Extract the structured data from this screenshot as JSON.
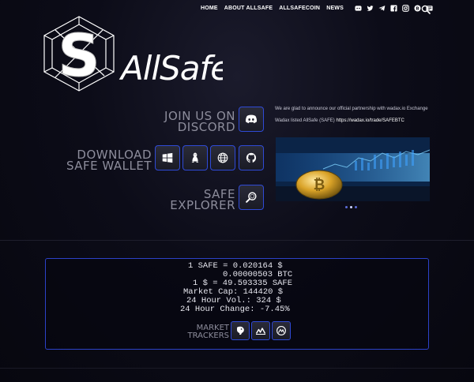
{
  "nav": {
    "links": [
      "HOME",
      "ABOUT ALLSAFE",
      "ALLSAFECOIN",
      "NEWS"
    ],
    "icons": [
      "discord-icon",
      "twitter-icon",
      "telegram-icon",
      "facebook-icon",
      "instagram-icon",
      "bitcointalk-icon",
      "medium-icon"
    ],
    "search_icon": "search-icon"
  },
  "logo": {
    "wordmark": "AllSafe",
    "mark_letter": "S"
  },
  "cta": {
    "discord": {
      "line1": "JOIN US ON",
      "line2": "DISCORD"
    },
    "wallet": {
      "line1": "DOWNLOAD",
      "line2": "SAFE WALLET"
    },
    "explorer": {
      "line1": "SAFE",
      "line2": "EXPLORER"
    }
  },
  "news": {
    "announcement": "We are glad to announce our official partnership with wadax.io Exchange",
    "listed_prefix": "Wadax listed AllSafe (SAFE) ",
    "listed_link": "https://wadax.io/trade/SAFEBTC",
    "slides": 3,
    "active_slide": 1
  },
  "price": {
    "line1": "1 SAFE = 0.020164 $",
    "line2": "0.00000503 BTC",
    "line3": "1 $ = 49.593335 SAFE",
    "line4": "Market Cap: 144420 $",
    "line5": "24 Hour Vol.: 324 $",
    "line6": "24 Hour Change: -7.45%"
  },
  "trackers": {
    "line1": "MARKET",
    "line2": "TRACKERS"
  },
  "colors": {
    "accent_border": "#2f4ad6",
    "background": "#0c0c18",
    "label_gray": "#8d8d9c"
  }
}
